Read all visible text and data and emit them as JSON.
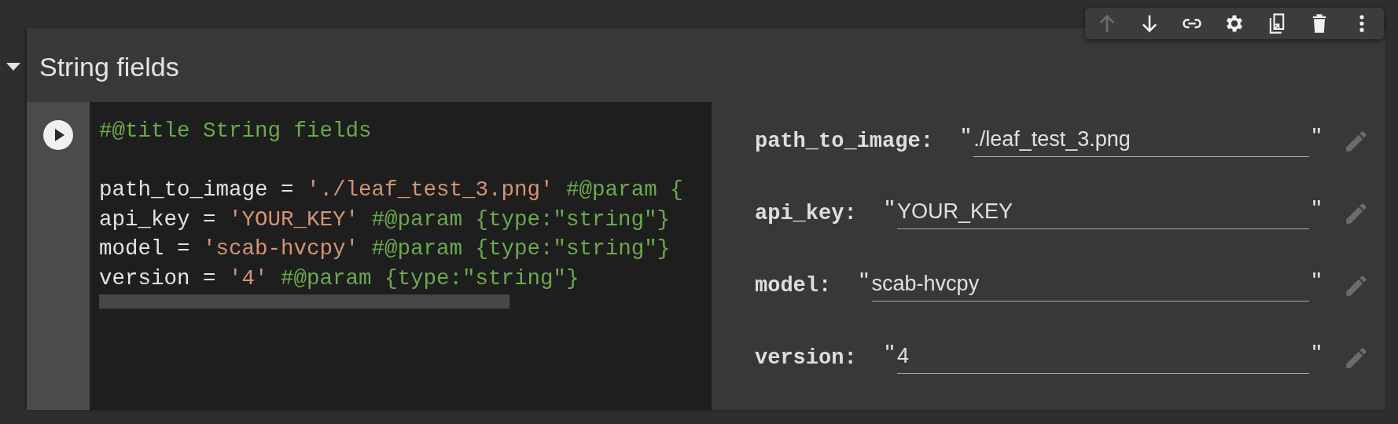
{
  "cell": {
    "title": "String fields",
    "expanded": true
  },
  "toolbar": [
    {
      "kind": "up",
      "disabled": true
    },
    {
      "kind": "down",
      "disabled": false
    },
    {
      "kind": "link",
      "disabled": false
    },
    {
      "kind": "settings",
      "disabled": false
    },
    {
      "kind": "mirror",
      "disabled": false
    },
    {
      "kind": "delete",
      "disabled": false
    },
    {
      "kind": "more",
      "disabled": false
    }
  ],
  "code": [
    {
      "kind": "text",
      "tokens": [
        {
          "kind": "comment",
          "text": "#@title String fields"
        }
      ]
    },
    {
      "kind": "blank"
    },
    {
      "kind": "text",
      "tokens": [
        {
          "kind": "plain",
          "text": "path_to_image = "
        },
        {
          "kind": "string",
          "text": "'./leaf_test_3.png'"
        },
        {
          "kind": "comment",
          "text": " #@param {"
        }
      ]
    },
    {
      "kind": "text",
      "tokens": [
        {
          "kind": "plain",
          "text": "api_key = "
        },
        {
          "kind": "string",
          "text": "'YOUR_KEY'"
        },
        {
          "kind": "comment",
          "text": " #@param {type:\"string\"}"
        }
      ]
    },
    {
      "kind": "text",
      "tokens": [
        {
          "kind": "plain",
          "text": "model = "
        },
        {
          "kind": "string",
          "text": "'scab-hvcpy'"
        },
        {
          "kind": "comment",
          "text": " #@param {type:\"string\"}"
        }
      ]
    },
    {
      "kind": "text",
      "tokens": [
        {
          "kind": "plain",
          "text": "version = "
        },
        {
          "kind": "string",
          "text": "'4'"
        },
        {
          "kind": "comment",
          "text": " #@param {type:\"string\"}"
        }
      ]
    }
  ],
  "form": [
    {
      "label": "path_to_image:",
      "quote_open": "\"",
      "value": "./leaf_test_3.png",
      "quote_close": "\""
    },
    {
      "label": "api_key:",
      "quote_open": "\"",
      "value": "YOUR_KEY",
      "quote_close": "\""
    },
    {
      "label": "model:",
      "quote_open": "\"",
      "value": "scab-hvcpy",
      "quote_close": "\""
    },
    {
      "label": "version:",
      "quote_open": "\"",
      "value": "4",
      "quote_close": "\""
    }
  ]
}
